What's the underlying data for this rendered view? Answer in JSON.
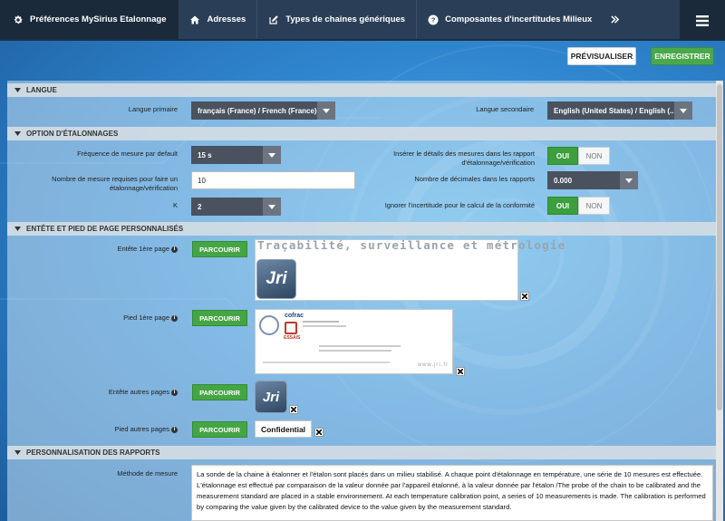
{
  "nav": {
    "title": "Préférences MySirius Etalonnage",
    "items": [
      {
        "label": "Adresses",
        "icon": "home-icon"
      },
      {
        "label": "Types de chaines génériques",
        "icon": "edit-icon"
      },
      {
        "label": "Composantes d'incertitudes Milieux",
        "icon": "help-icon"
      }
    ],
    "more_icon": "double-chevron-right-icon",
    "menu_icon": "hamburger-menu-icon"
  },
  "actions": {
    "preview_label": "PRÉVISUALISER",
    "save_label": "ENREGISTRER"
  },
  "sections": {
    "langue": {
      "title": "LANGUE",
      "primary_label": "Langue primaire",
      "primary_value": "français (France) / French (France)",
      "secondary_label": "Langue secondaire",
      "secondary_value": "English (United States) / English (..."
    },
    "etalonnage": {
      "title": "OPTION D'ÉTALONNAGES",
      "freq_label": "Fréquence de mesure par default",
      "freq_value": "15 s",
      "nb_mesures_label": "Nombre de mesure requises pour faire un étalonnage/vérification",
      "nb_mesures_value": "10",
      "k_label": "K",
      "k_value": "2",
      "inserer_label": "Insérer le détails des mesures dans les rapport d'étalonnage/vérification",
      "decimales_label": "Nombre de décimales dans les rapports",
      "decimales_value": "0.000",
      "ignorer_label": "Ignorer l'incertitude pour le calcul de la conformité",
      "toggle_on": "OUI",
      "toggle_off": "NON"
    },
    "entete": {
      "title": "ENTÊTE ET PIED DE PAGE PERSONNALISÉS",
      "entete1_label": "Entête 1ère page",
      "pied1_label": "Pied 1ère page",
      "entete_autres_label": "Entête autres pages",
      "pied_autres_label": "Pied autres pages",
      "browse_label": "PARCOURIR",
      "banner_text": "Traçabilité, surveillance et métrologie",
      "logo_text": "Jri",
      "confidential_text": "Confidential",
      "cofrac_text": "cofrac",
      "essais_text": "ESSAIS",
      "footer_url": "www.jri.fr"
    },
    "rapports": {
      "title": "PERSONNALISATION DES RAPPORTS",
      "methode_label": "Méthode de mesure",
      "methode_text": "La sonde de la chaine à étalonner et l'étalon sont placés dans un milieu stabilisé. A chaque point d'étalonnage en température, une série de 10 mesures est effectuée. L'étalonnage est effectué par comparaison de la valeur donnée par l'appareil étalonné, à la valeur donnée par l'étalon /The probe of the chain to be calibrated and the measurement standard are placed in a stable environnement. At each temperature calibration point, a series of 10 measurements is made. The calibration is performed by comparing the value given by the calibrated device to the value given by the measurement standard."
    }
  },
  "colors": {
    "nav_bg": "#2a3f57",
    "nav_active_bg": "#1b2a3b",
    "accent_green": "#45a545",
    "select_bg": "#4a5260"
  }
}
